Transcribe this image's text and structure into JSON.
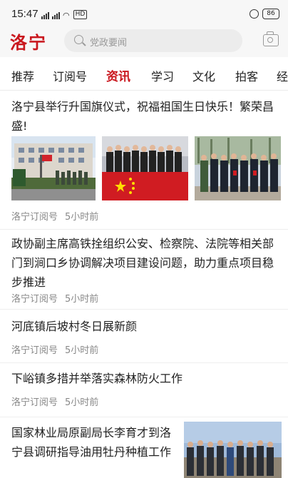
{
  "status_bar": {
    "time": "15:47",
    "network": "HD",
    "battery": "86"
  },
  "header": {
    "logo": "洛宁",
    "search_placeholder": "党政要闻"
  },
  "tabs": [
    "推荐",
    "订阅号",
    "资讯",
    "学习",
    "文化",
    "拍客",
    "经"
  ],
  "active_tab": "资讯",
  "articles": [
    {
      "title": "洛宁县举行升国旗仪式，祝福祖国生日快乐！繁荣昌盛!",
      "source": "洛宁订阅号",
      "time": "5小时前"
    },
    {
      "title": "政协副主席高铁拴组织公安、检察院、法院等相关部门到涧口乡协调解决项目建设问题，助力重点项目稳步推进",
      "source": "洛宁订阅号",
      "time": "5小时前"
    },
    {
      "title": "河底镇后坡村冬日展新颜",
      "source": "洛宁订阅号",
      "time": "5小时前"
    },
    {
      "title": "下峪镇多措并举落实森林防火工作",
      "source": "洛宁订阅号",
      "time": "5小时前"
    },
    {
      "title": "国家林业局原副局长李育才到洛宁县调研指导油用牡丹种植工作"
    }
  ]
}
